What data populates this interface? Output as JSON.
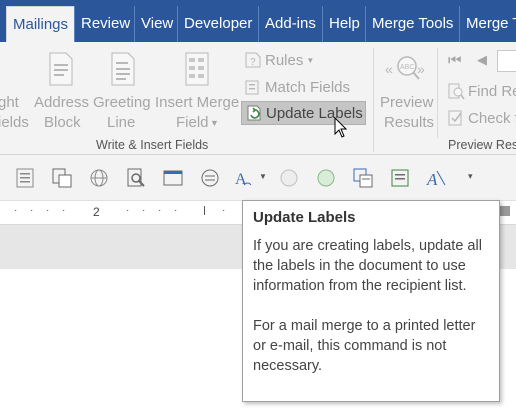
{
  "tabs": [
    {
      "label": "Mailings",
      "active": true
    },
    {
      "label": "Review"
    },
    {
      "label": "View"
    },
    {
      "label": "Developer"
    },
    {
      "label": "Add-ins"
    },
    {
      "label": "Help"
    },
    {
      "label": "Merge Tools"
    },
    {
      "label": "Merge T"
    }
  ],
  "ribbon": {
    "partial_left_top": "ght",
    "partial_left_bottom": "ields",
    "address_block": {
      "line1": "Address",
      "line2": "Block"
    },
    "greeting_line": {
      "line1": "Greeting",
      "line2": "Line"
    },
    "insert_merge_field": {
      "line1": "Insert Merge",
      "line2": "Field"
    },
    "rules": "Rules",
    "match_fields": "Match Fields",
    "update_labels": "Update Labels",
    "group_write_insert": "Write & Insert Fields",
    "preview_results": {
      "line1": "Preview",
      "line2": "Results"
    },
    "find_recipient": "Find Re",
    "check_for_errors": "Check f",
    "group_preview": "Preview Res"
  },
  "ruler": {
    "tick_label": "2"
  },
  "tooltip": {
    "title": "Update Labels",
    "para1": "If you are creating labels, update all the labels in the document to use information from the recipient list.",
    "para2": "For a mail merge to a printed letter or e-mail, this command is not necessary."
  },
  "colors": {
    "tab_bar": "#2b579a",
    "ribbon_bg": "#f3f3f3",
    "highlight": "#c5c5c5"
  }
}
